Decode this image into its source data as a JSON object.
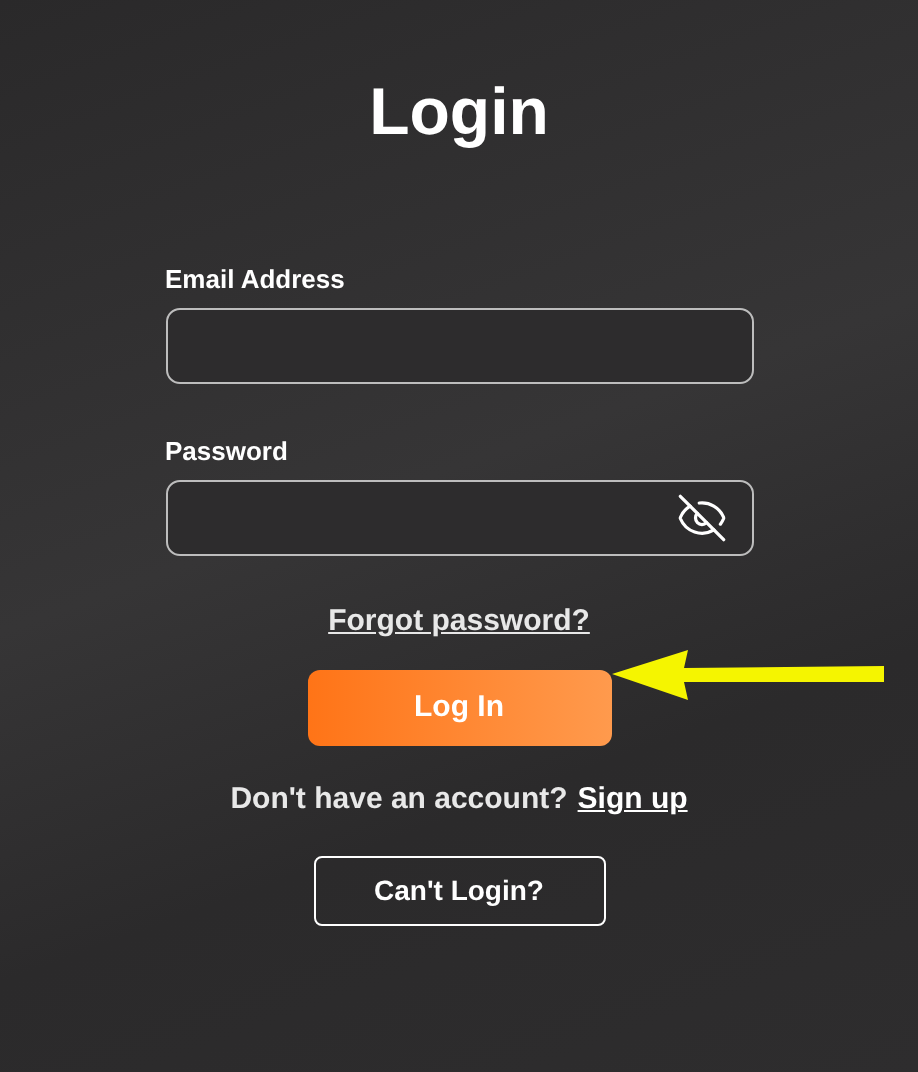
{
  "title": "Login",
  "fields": [
    {
      "label": "Email Address",
      "kind": "text"
    },
    {
      "label": "Password",
      "kind": "password"
    }
  ],
  "forgot_link": "Forgot password?",
  "login_button": "Log In",
  "signup": {
    "prompt": "Don't have an account?",
    "link": "Sign up"
  },
  "cant_login_button": "Can't Login?"
}
